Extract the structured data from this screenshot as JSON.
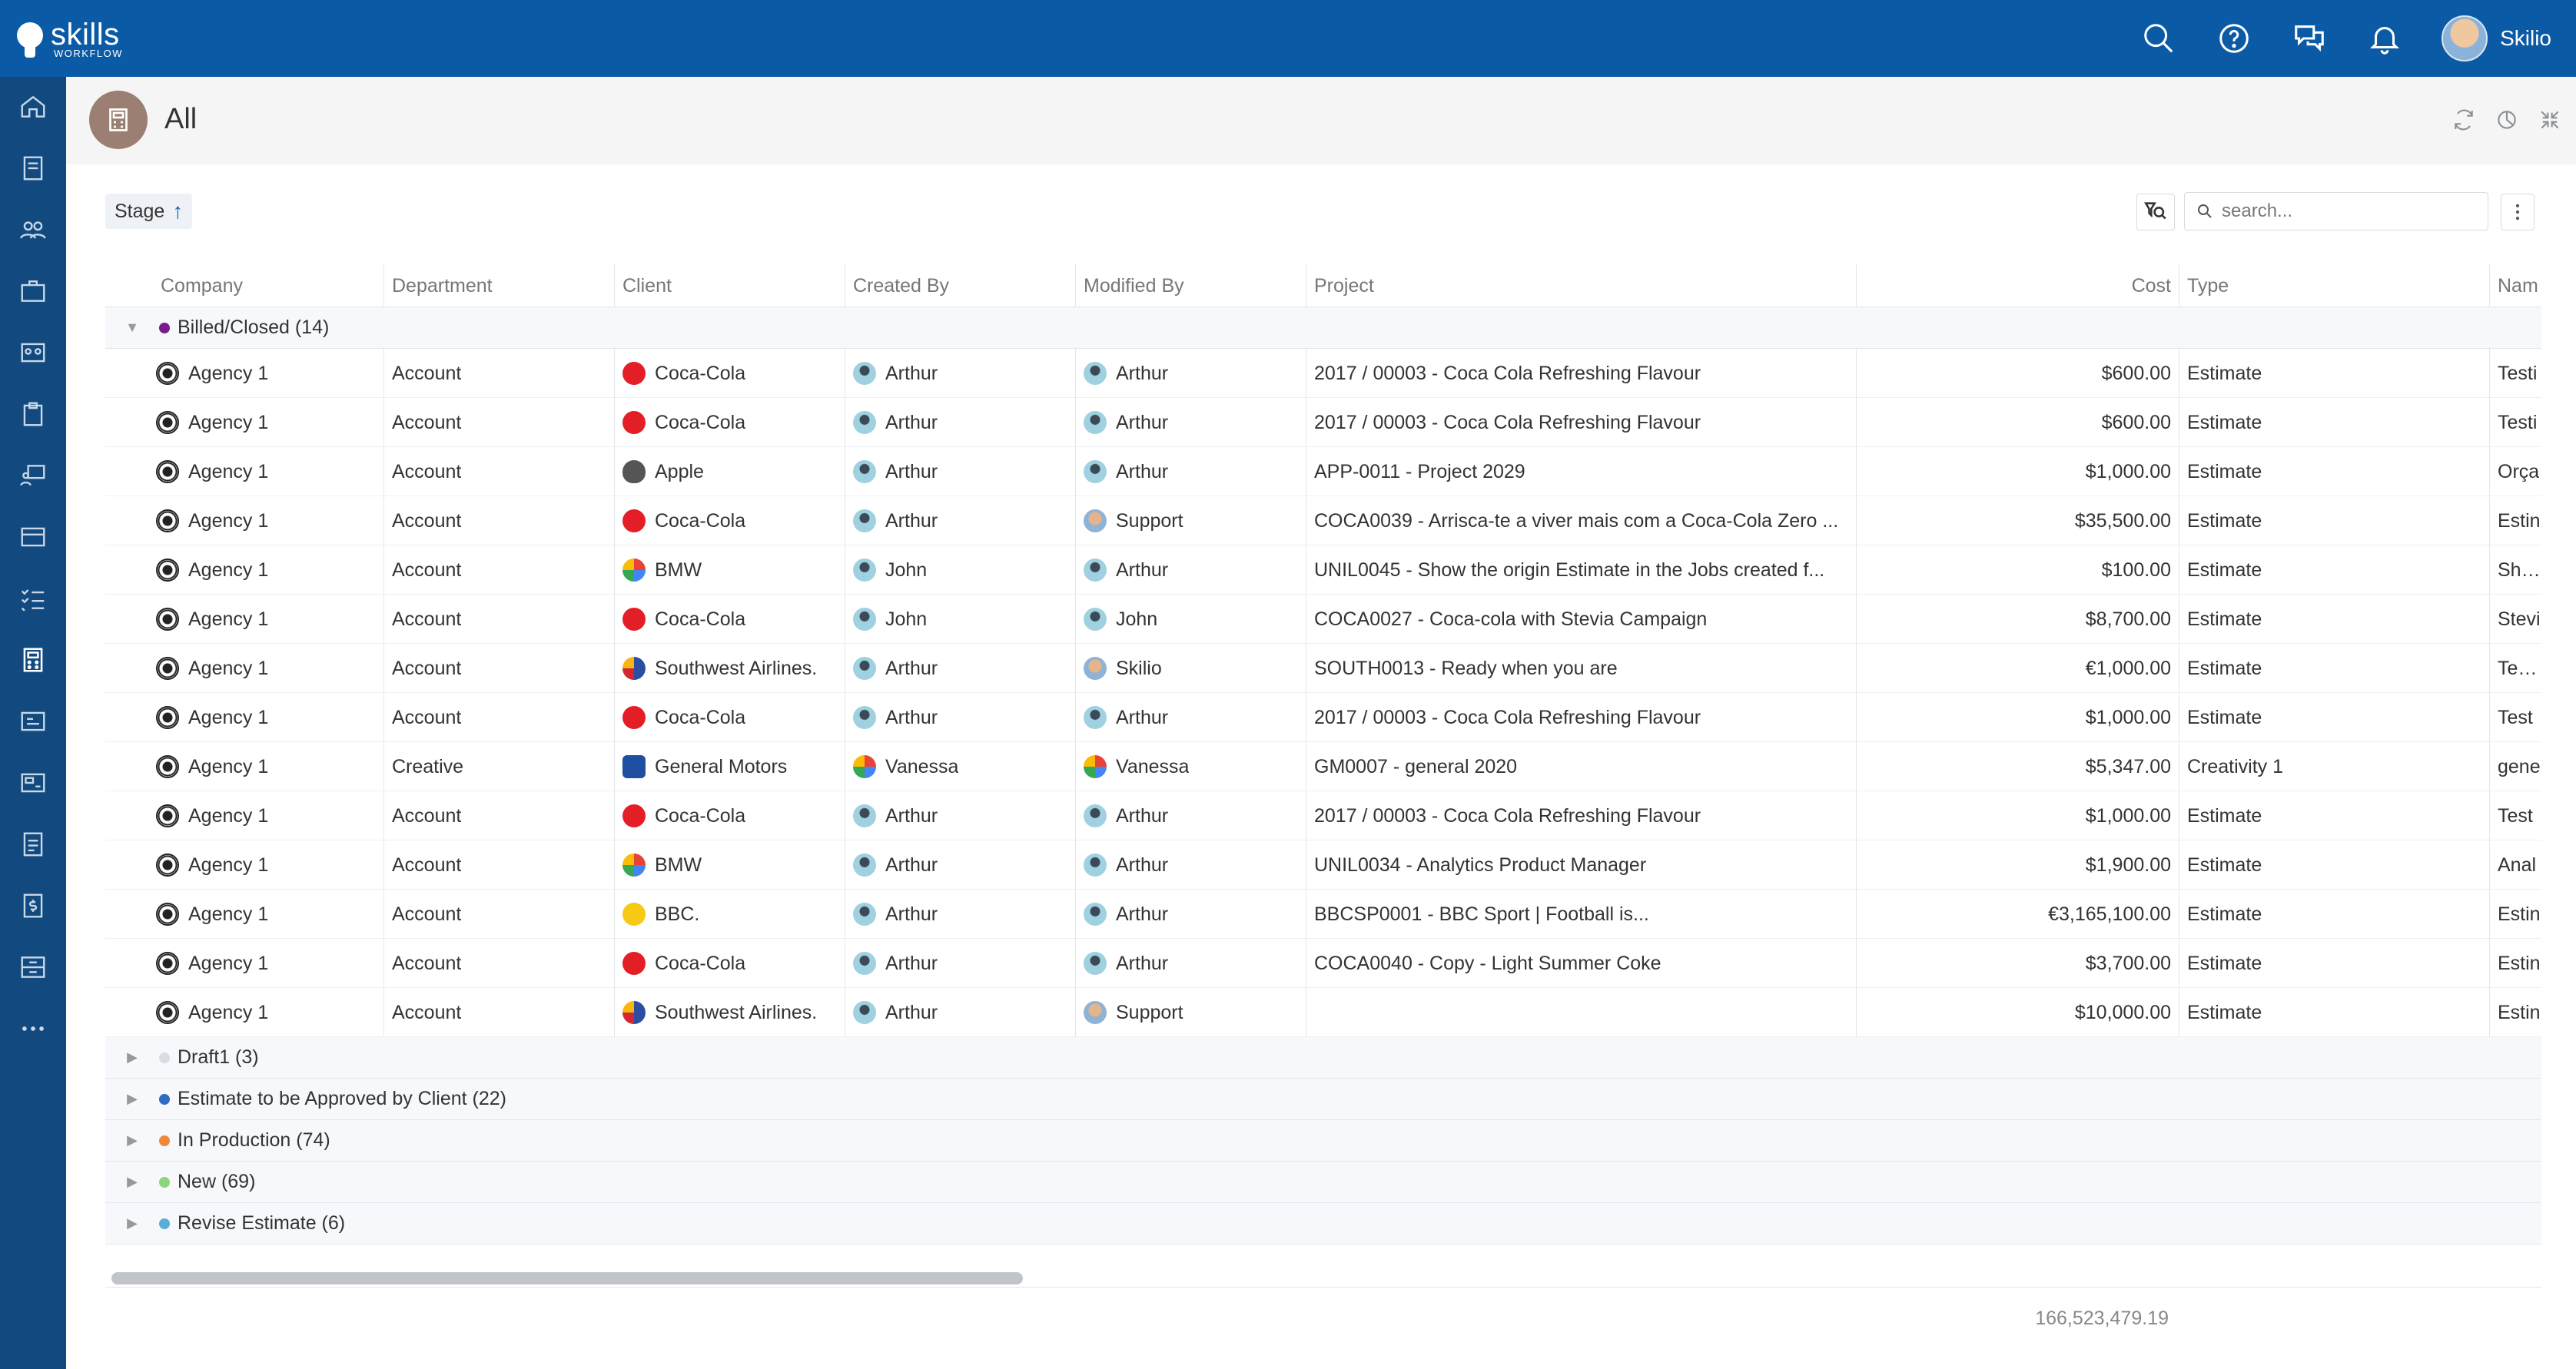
{
  "app": {
    "logo_main": "skills",
    "logo_sub": "WORKFLOW",
    "user_name": "Skilio",
    "top_icons": [
      "search-icon",
      "help-icon",
      "chat-icon",
      "bell-icon"
    ],
    "brand_color": "#0b5aa6",
    "sidebar_color": "#124a80"
  },
  "sidebar": {
    "items": [
      "home-icon",
      "document-icon",
      "people-icon",
      "briefcase-icon",
      "team-icon",
      "clipboard-icon",
      "presentation-icon",
      "card-icon",
      "checklist-icon",
      "calculator-icon",
      "id-card-icon",
      "invoice-icon",
      "report-icon",
      "billing-icon",
      "archive-icon",
      "more-icon"
    ]
  },
  "header": {
    "title": "All"
  },
  "toolbar": {
    "group_by_label": "Stage",
    "search_placeholder": "search..."
  },
  "grid": {
    "columns": [
      "Company",
      "Department",
      "Client",
      "Created By",
      "Modified By",
      "Project",
      "Cost",
      "Type",
      "Nam"
    ],
    "groups": [
      {
        "label": "Billed/Closed (14)",
        "color": "#7b1b8c",
        "expanded": true
      },
      {
        "label": "Draft1 (3)",
        "color": "#d9dde2",
        "expanded": false
      },
      {
        "label": "Estimate to be Approved by Client (22)",
        "color": "#2f6bc0",
        "expanded": false
      },
      {
        "label": "In Production (74)",
        "color": "#f0883a",
        "expanded": false
      },
      {
        "label": "New (69)",
        "color": "#8ed47a",
        "expanded": false
      },
      {
        "label": "Revise Estimate (6)",
        "color": "#5aaed6",
        "expanded": false
      }
    ],
    "rows": [
      {
        "company": "Agency 1",
        "department": "Account",
        "client": "Coca-Cola",
        "client_icon": "coke",
        "created_by": "Arthur",
        "created_icon": "person",
        "modified_by": "Arthur",
        "modified_icon": "person",
        "project": "2017 / 00003 - Coca Cola Refreshing Flavour",
        "cost": "$600.00",
        "type": "Estimate",
        "name": "Testi"
      },
      {
        "company": "Agency 1",
        "department": "Account",
        "client": "Coca-Cola",
        "client_icon": "coke",
        "created_by": "Arthur",
        "created_icon": "person",
        "modified_by": "Arthur",
        "modified_icon": "person",
        "project": "2017 / 00003 - Coca Cola Refreshing Flavour",
        "cost": "$600.00",
        "type": "Estimate",
        "name": "Testi"
      },
      {
        "company": "Agency 1",
        "department": "Account",
        "client": "Apple",
        "client_icon": "apple",
        "created_by": "Arthur",
        "created_icon": "person",
        "modified_by": "Arthur",
        "modified_icon": "person",
        "project": "APP-0011 - Project 2029",
        "cost": "$1,000.00",
        "type": "Estimate",
        "name": "Orça"
      },
      {
        "company": "Agency 1",
        "department": "Account",
        "client": "Coca-Cola",
        "client_icon": "coke",
        "created_by": "Arthur",
        "created_icon": "person",
        "modified_by": "Support",
        "modified_icon": "support",
        "project": "COCA0039 - Arrisca-te a viver mais com a Coca-Cola Zero ...",
        "cost": "$35,500.00",
        "type": "Estimate",
        "name": "Estin"
      },
      {
        "company": "Agency 1",
        "department": "Account",
        "client": "BMW",
        "client_icon": "bmw",
        "created_by": "John",
        "created_icon": "person",
        "modified_by": "Arthur",
        "modified_icon": "person",
        "project": "UNIL0045 - Show the origin Estimate in the Jobs created f...",
        "cost": "$100.00",
        "type": "Estimate",
        "name": "Show"
      },
      {
        "company": "Agency 1",
        "department": "Account",
        "client": "Coca-Cola",
        "client_icon": "coke",
        "created_by": "John",
        "created_icon": "person",
        "modified_by": "John",
        "modified_icon": "person",
        "project": "COCA0027 - Coca-cola with Stevia Campaign",
        "cost": "$8,700.00",
        "type": "Estimate",
        "name": "Stevi"
      },
      {
        "company": "Agency 1",
        "department": "Account",
        "client": "Southwest Airlines.",
        "client_icon": "sw",
        "created_by": "Arthur",
        "created_icon": "person",
        "modified_by": "Skilio",
        "modified_icon": "support",
        "project": "SOUTH0013 - Ready when you are",
        "cost": "€1,000.00",
        "type": "Estimate",
        "name": "Teste"
      },
      {
        "company": "Agency 1",
        "department": "Account",
        "client": "Coca-Cola",
        "client_icon": "coke",
        "created_by": "Arthur",
        "created_icon": "person",
        "modified_by": "Arthur",
        "modified_icon": "person",
        "project": "2017 / 00003 - Coca Cola Refreshing Flavour",
        "cost": "$1,000.00",
        "type": "Estimate",
        "name": "Test"
      },
      {
        "company": "Agency 1",
        "department": "Creative",
        "client": "General Motors",
        "client_icon": "gm",
        "created_by": "Vanessa",
        "created_icon": "vanessa",
        "modified_by": "Vanessa",
        "modified_icon": "vanessa",
        "project": "GM0007 - general 2020",
        "cost": "$5,347.00",
        "type": "Creativity 1",
        "name": "gene"
      },
      {
        "company": "Agency 1",
        "department": "Account",
        "client": "Coca-Cola",
        "client_icon": "coke",
        "created_by": "Arthur",
        "created_icon": "person",
        "modified_by": "Arthur",
        "modified_icon": "person",
        "project": "2017 / 00003 - Coca Cola Refreshing Flavour",
        "cost": "$1,000.00",
        "type": "Estimate",
        "name": "Test"
      },
      {
        "company": "Agency 1",
        "department": "Account",
        "client": "BMW",
        "client_icon": "bmw",
        "created_by": "Arthur",
        "created_icon": "person",
        "modified_by": "Arthur",
        "modified_icon": "person",
        "project": "UNIL0034 - Analytics Product Manager",
        "cost": "$1,900.00",
        "type": "Estimate",
        "name": "Anal"
      },
      {
        "company": "Agency 1",
        "department": "Account",
        "client": "BBC.",
        "client_icon": "bbc",
        "created_by": "Arthur",
        "created_icon": "person",
        "modified_by": "Arthur",
        "modified_icon": "person",
        "project": "BBCSP0001 - BBC Sport | Football is...",
        "cost": "€3,165,100.00",
        "type": "Estimate",
        "name": "Estin"
      },
      {
        "company": "Agency 1",
        "department": "Account",
        "client": "Coca-Cola",
        "client_icon": "coke",
        "created_by": "Arthur",
        "created_icon": "person",
        "modified_by": "Arthur",
        "modified_icon": "person",
        "project": "COCA0040 - Copy - Light Summer Coke",
        "cost": "$3,700.00",
        "type": "Estimate",
        "name": "Estin"
      },
      {
        "company": "Agency 1",
        "department": "Account",
        "client": "Southwest Airlines.",
        "client_icon": "sw",
        "created_by": "Arthur",
        "created_icon": "person",
        "modified_by": "Support",
        "modified_icon": "support",
        "project": "",
        "cost": "$10,000.00",
        "type": "Estimate",
        "name": "Estin"
      }
    ],
    "total_cost": "166,523,479.19"
  }
}
